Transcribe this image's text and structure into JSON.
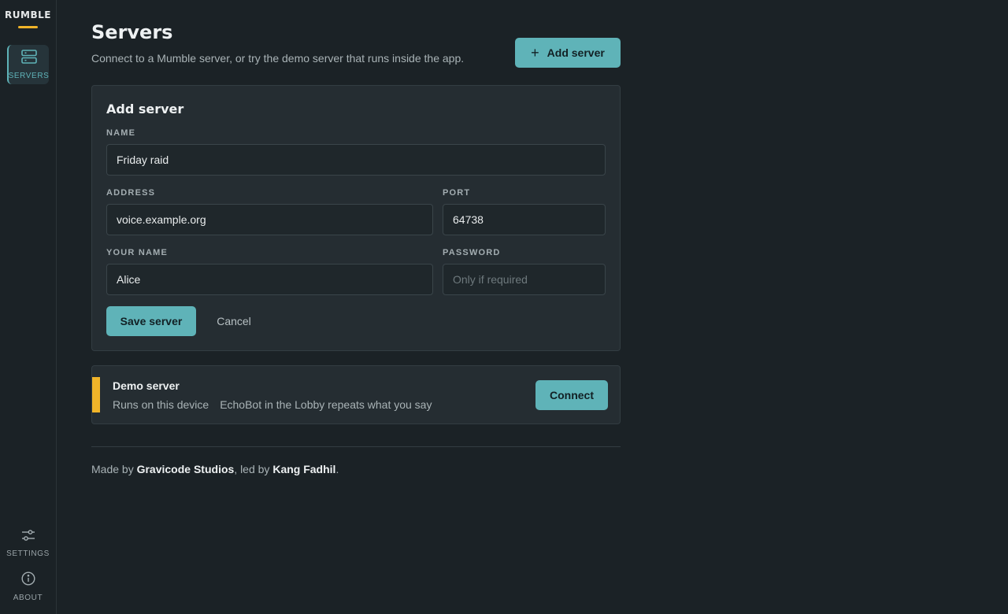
{
  "app": {
    "brand": "RUMBLE",
    "accent": "#f0b429",
    "primary": "#5fb3b8"
  },
  "sidebar": {
    "servers": {
      "label": "SERVERS",
      "icon": "server-icon",
      "active": true
    },
    "settings": {
      "label": "SETTINGS",
      "icon": "sliders-icon"
    },
    "about": {
      "label": "ABOUT",
      "icon": "info-icon"
    }
  },
  "header": {
    "title": "Servers",
    "subtitle": "Connect to a Mumble server, or try the demo server that runs inside the app.",
    "add_button": "Add server",
    "add_icon": "plus-icon"
  },
  "form": {
    "title": "Add server",
    "name_label": "NAME",
    "name_value": "Friday raid",
    "address_label": "ADDRESS",
    "address_value": "voice.example.org",
    "port_label": "PORT",
    "port_value": "64738",
    "yourname_label": "YOUR NAME",
    "yourname_value": "Alice",
    "password_label": "PASSWORD",
    "password_value": "",
    "password_placeholder": "Only if required",
    "save_label": "Save server",
    "cancel_label": "Cancel"
  },
  "demo": {
    "title": "Demo server",
    "meta_left": "Runs on this device",
    "meta_right": "EchoBot in the Lobby repeats what you say",
    "connect_label": "Connect"
  },
  "footer": {
    "prefix": "Made by ",
    "studio": "Gravicode Studios",
    "middle": ", led by ",
    "lead": "Kang Fadhil",
    "suffix": "."
  }
}
